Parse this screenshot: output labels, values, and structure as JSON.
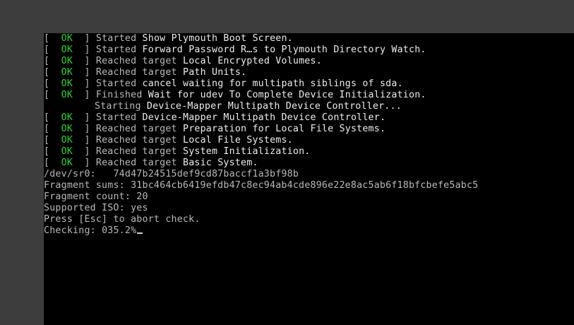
{
  "boot_log": [
    {
      "status": "OK",
      "verb": "Started",
      "desc": "Show Plymouth Boot Screen."
    },
    {
      "status": "OK",
      "verb": "Started",
      "desc": "Forward Password R…s to Plymouth Directory Watch."
    },
    {
      "status": "OK",
      "verb": "Reached target",
      "desc": "Local Encrypted Volumes."
    },
    {
      "status": "OK",
      "verb": "Reached target",
      "desc": "Path Units."
    },
    {
      "status": "OK",
      "verb": "Started",
      "desc": "cancel waiting for multipath siblings of sda."
    },
    {
      "status": "OK",
      "verb": "Finished",
      "desc": "Wait for udev To Complete Device Initialization."
    },
    {
      "status": "",
      "verb": "Starting",
      "desc": "Device-Mapper Multipath Device Controller..."
    },
    {
      "status": "OK",
      "verb": "Started",
      "desc": "Device-Mapper Multipath Device Controller."
    },
    {
      "status": "OK",
      "verb": "Reached target",
      "desc": "Preparation for Local File Systems."
    },
    {
      "status": "OK",
      "verb": "Reached target",
      "desc": "Local File Systems."
    },
    {
      "status": "OK",
      "verb": "Reached target",
      "desc": "System Initialization."
    },
    {
      "status": "OK",
      "verb": "Reached target",
      "desc": "Basic System."
    }
  ],
  "check_output": [
    "/dev/sr0:   74d47b24515def9cd87baccf1a3bf98b",
    "Fragment sums: 31bc464cb6419efdb47c8ec94ab4cde896e22e8ac5ab6f18bfcbefe5abc5",
    "Fragment count: 20",
    "Supported ISO: yes",
    "Press [Esc] to abort check."
  ],
  "checking": {
    "label": "Checking: ",
    "value": "035.2%"
  },
  "colors": {
    "ok": "#2fd12f",
    "text": "#b8b8b8",
    "highlight": "#ececec",
    "background": "#000000",
    "frame": "#3c3c3c"
  }
}
